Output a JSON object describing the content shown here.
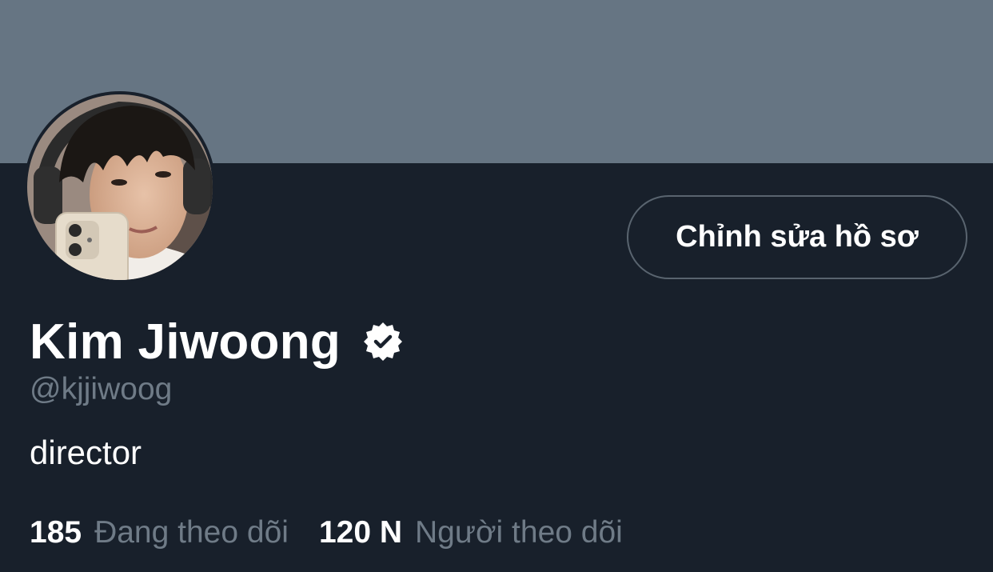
{
  "profile": {
    "display_name": "Kim Jiwoong",
    "handle": "@kjjiwoog",
    "bio": "director",
    "verified_icon": "verified-badge-icon",
    "edit_button_label": "Chỉnh sửa hồ sơ",
    "following": {
      "count": "185",
      "label": "Đang theo dõi"
    },
    "followers": {
      "count": "120 N",
      "label": "Người theo dõi"
    }
  },
  "colors": {
    "banner": "#667583",
    "background": "#18202b",
    "muted_text": "#6f7b87",
    "button_border": "#59646f"
  }
}
